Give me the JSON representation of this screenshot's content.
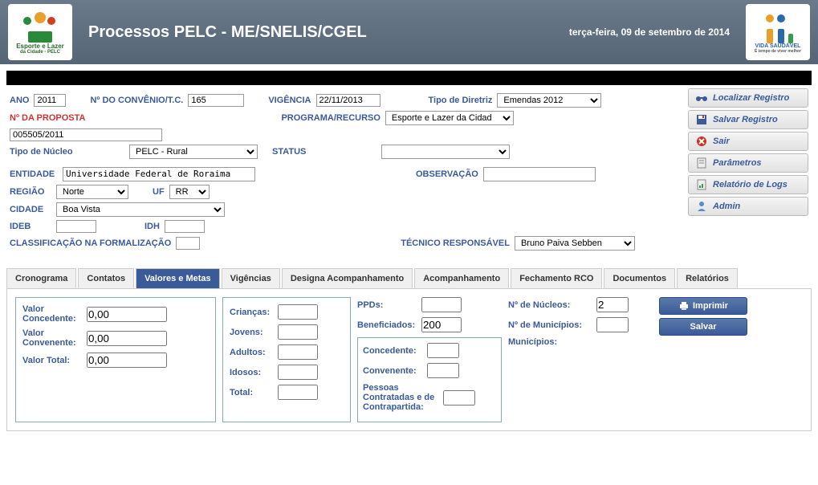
{
  "header": {
    "title": "Processos PELC - ME/SNELIS/CGEL",
    "date": "terça-feira, 09 de setembro de 2014",
    "logo_left_top": "Esporte e Lazer",
    "logo_left_bot": "da Cidade - PELC",
    "logo_right_top": "VIDA SAUDÁVEL",
    "logo_right_bot": "É tempo de viver melhor"
  },
  "form": {
    "ano_lbl": "ANO",
    "ano": "2011",
    "convenio_lbl": "Nº DO CONVÊNIO/T.C.",
    "convenio": "165",
    "vigencia_lbl": "VIGÊNCIA",
    "vigencia": "22/11/2013",
    "diretriz_lbl": "Tipo de Diretriz",
    "diretriz": "Emendas 2012",
    "proposta_lbl": "Nº DA PROPOSTA",
    "proposta": "005505/2011",
    "programa_lbl": "PROGRAMA/RECURSO",
    "programa": "Esporte e Lazer da Cidad",
    "nucleo_lbl": "Tipo de Núcleo",
    "nucleo": "PELC - Rural",
    "status_lbl": "STATUS",
    "status": "",
    "entidade_lbl": "ENTIDADE",
    "entidade": "Universidade Federal de Roraima",
    "observacao_lbl": "OBSERVAÇÃO",
    "observacao": "",
    "regiao_lbl": "REGIÃO",
    "regiao": "Norte",
    "uf_lbl": "UF",
    "uf": "RR",
    "cidade_lbl": "CIDADE",
    "cidade": "Boa Vista",
    "ideb_lbl": "IDEB",
    "ideb": "",
    "idh_lbl": "IDH",
    "idh": "",
    "classif_lbl": "CLASSIFICAÇÃO NA FORMALIZAÇÃO",
    "classif": "",
    "tecnico_lbl": "TÉCNICO RESPONSÁVEL",
    "tecnico": "Bruno Paiva Sebben"
  },
  "sidebar": {
    "localizar": "Localizar Registro",
    "salvar": "Salvar Registro",
    "sair": "Sair",
    "parametros": "Parâmetros",
    "logs": "Relatório de Logs",
    "admin": "Admin"
  },
  "tabs": {
    "t0": "Cronograma",
    "t1": "Contatos",
    "t2": "Valores e Metas",
    "t3": "Vigências",
    "t4": "Designa Acompanhamento",
    "t5": "Acompanhamento",
    "t6": "Fechamento RCO",
    "t7": "Documentos",
    "t8": "Relatórios"
  },
  "valores": {
    "concedente_lbl": "Valor Concedente:",
    "concedente": "0,00",
    "convenente_lbl": "Valor Convenente:",
    "convenente": "0,00",
    "total_lbl": "Valor Total:",
    "total": "0,00",
    "criancas_lbl": "Crianças:",
    "criancas": "",
    "jovens_lbl": "Jovens:",
    "jovens": "",
    "adultos_lbl": "Adultos:",
    "adultos": "",
    "idosos_lbl": "Idosos:",
    "idosos": "",
    "total2_lbl": "Total:",
    "total2": "",
    "ppds_lbl": "PPDs:",
    "ppds": "",
    "benef_lbl": "Beneficiados:",
    "benef": "200",
    "conc2_lbl": "Concedente:",
    "conc2": "",
    "conv2_lbl": "Convenente:",
    "conv2": "",
    "pessoas_lbl": "Pessoas Contratadas e de Contrapartida:",
    "pessoas": "",
    "nucleos_lbl": "Nº de Núcleos:",
    "nucleos": "2",
    "municipios_lbl": "Nº de Municípios:",
    "municipios": "",
    "munlist_lbl": "Municípios:"
  },
  "actions": {
    "imprimir": "Imprimir",
    "salvar": "Salvar"
  }
}
